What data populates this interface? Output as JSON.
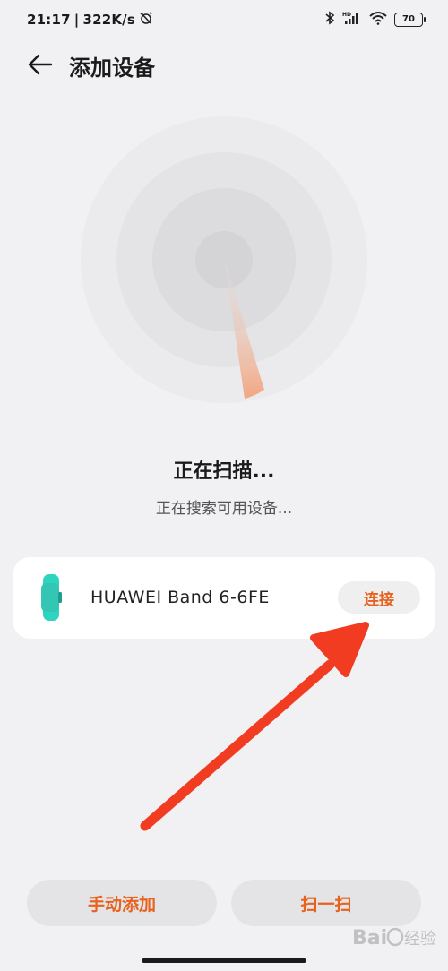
{
  "status_bar": {
    "time": "21:17",
    "net_speed": "322K/s",
    "battery_level": "70",
    "icons": [
      "alarm-off-icon",
      "bluetooth-icon",
      "hd-signal-icon",
      "wifi-icon",
      "battery-icon"
    ]
  },
  "header": {
    "title": "添加设备",
    "back_icon": "arrow-left-icon"
  },
  "scan": {
    "title": "正在扫描...",
    "subtitle": "正在搜索可用设备..."
  },
  "device": {
    "name": "HUAWEI Band 6-6FE",
    "icon": "smart-band-icon",
    "connect_label": "连接"
  },
  "bottom": {
    "manual_add_label": "手动添加",
    "scan_label": "扫一扫"
  },
  "watermark": {
    "text": "Bai 经验"
  },
  "colors": {
    "accent": "#e8621e",
    "band": "#2dd4bf",
    "background": "#f1f1f3",
    "card": "#ffffff",
    "arrow": "#f23c21"
  }
}
